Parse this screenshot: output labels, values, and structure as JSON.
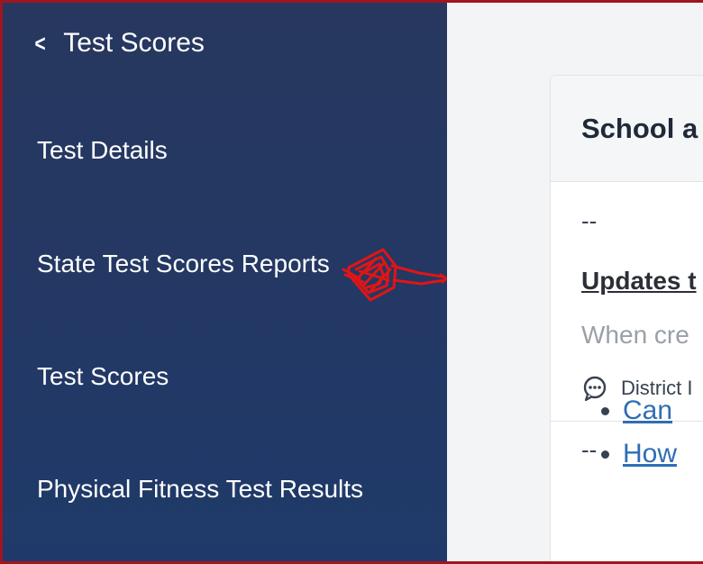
{
  "sidebar": {
    "back_label": "Test Scores",
    "items": [
      {
        "label": "Test Details"
      },
      {
        "label": "State Test Scores Reports"
      },
      {
        "label": "Test Scores"
      },
      {
        "label": "Physical Fitness Test Results"
      }
    ]
  },
  "main": {
    "card_title": "School a",
    "dash_1": "--",
    "update_link": "Updates t",
    "description": "When cre",
    "meta_text": "District I",
    "dash_2": "--",
    "bullets": [
      "Can",
      "How"
    ]
  },
  "colors": {
    "sidebar_bg": "#233864",
    "frame_border": "#a0151f",
    "annotation": "#e01515",
    "link": "#2f6db5"
  }
}
